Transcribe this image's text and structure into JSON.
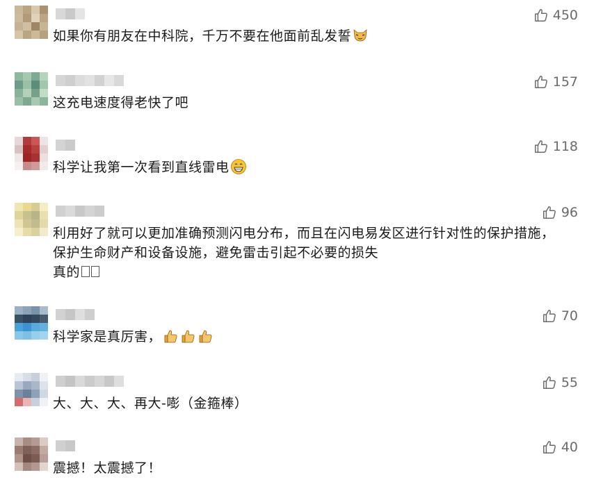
{
  "comments": [
    {
      "likes": "450",
      "text": "如果你有朋友在中科院，千万不要在他面前乱发誓",
      "emoji": "cat-face-icon",
      "avatar_colors": [
        "#c9b89c",
        "#b9a583",
        "#d8c8ae",
        "#a99272",
        "#cdbb9e",
        "#b29a78",
        "#e0d2bb",
        "#bda684",
        "#c5b294",
        "#d0bfa2",
        "#9f8766",
        "#c8b596",
        "#d6c5a7",
        "#bba483",
        "#ccb99a",
        "#b7a07e"
      ],
      "nick_colors": [
        "#d8d8d8",
        "#c9c9c9",
        "#e4e4e4"
      ]
    },
    {
      "likes": "157",
      "text": "这充电速度得老快了吧",
      "avatar_colors": [
        "#8fb89e",
        "#a6c9ad",
        "#7ea995",
        "#b7d3bd",
        "#6f9c8a",
        "#9ac0a5",
        "#5e8c7a",
        "#a3c6ae",
        "#88b39a",
        "#b4d0ba",
        "#789f8c",
        "#c3dcc6",
        "#9bbfa6",
        "#7ea893",
        "#a8c9b0",
        "#8bb59c"
      ],
      "nick_colors": [
        "#d6d6d6",
        "#cfcfcf",
        "#dcdcdc",
        "#e2e2e2",
        "#d2d2d2",
        "#e6e6e6",
        "#d9d9d9"
      ]
    },
    {
      "likes": "118",
      "text": "科学让我第一次看到直线雷电",
      "emoji": "grin-face-icon",
      "avatar_colors": [
        "#e6d8d8",
        "#b33a3a",
        "#c85858",
        "#efe4e4",
        "#d8c2c2",
        "#a52a2a",
        "#b84040",
        "#e2cfcf",
        "#f0e8e8",
        "#9c2424",
        "#a83232",
        "#ece0e0",
        "#f6f0f0",
        "#c88a8a",
        "#d09a9a",
        "#f2eaea"
      ],
      "nick_colors": [
        "#d4d4d4",
        "#cacaca"
      ]
    },
    {
      "likes": "96",
      "text": "利用好了就可以更加准确预测闪电分布，而且在闪电易发区进行针对性的保护措施，保护生命财产和设备设施，避免雷击引起不必要的损失\n真的",
      "avatar_colors": [
        "#f0e6b0",
        "#e8d98e",
        "#d8cc92",
        "#f4ecc2",
        "#e0d49a",
        "#c8c08e",
        "#b8b48a",
        "#e9dfb0",
        "#ede3b6",
        "#d1c691",
        "#c2bb8d",
        "#e4daa9",
        "#f5efcd",
        "#e7dca7",
        "#dcd19d",
        "#f2eaca"
      ],
      "nick_colors": [
        "#d0d0d0",
        "#dadada",
        "#c8c8c8",
        "#d4d4d4",
        "#cccccc"
      ]
    },
    {
      "likes": "70",
      "text": "科学家是真厉害，",
      "emoji": "thumbs-up-emoji-icon",
      "emoji_count": 3,
      "avatar_colors": [
        "#9bb0c4",
        "#8aa2b8",
        "#7892aa",
        "#a9bccd",
        "#3d4f63",
        "#2f4257",
        "#34485e",
        "#485a6d",
        "#4aa0d8",
        "#3b94d0",
        "#56aadd",
        "#62b2e0",
        "#8cc6ea",
        "#7fbfe6",
        "#98cdec",
        "#a5d3ee"
      ],
      "nick_colors": [
        "#d2d2d2",
        "#c6c6c6",
        "#dedede",
        "#cecece"
      ]
    },
    {
      "likes": "55",
      "text": "大、大、大、再大-嘭（金箍棒）",
      "avatar_colors": [
        "#e8ecf2",
        "#d8dee8",
        "#c6cfdb",
        "#eef1f5",
        "#b9c4d4",
        "#98a8be",
        "#a9b7ca",
        "#dde3eb",
        "#7f92ab",
        "#6c8099",
        "#8fa1b6",
        "#cfd7e2",
        "#d46c6c",
        "#e8b4b4",
        "#c8d0dc",
        "#eef1f5"
      ],
      "nick_colors": [
        "#cfcfcf",
        "#c4c4c4",
        "#d9d9d9",
        "#cbcbcb",
        "#d6d6d6",
        "#c8c8c8",
        "#dedede"
      ]
    },
    {
      "likes": "40",
      "text": "震撼！太震撼了！",
      "avatar_colors": [
        "#c8b4ae",
        "#a88c84",
        "#b49a92",
        "#dccbc5",
        "#9a7c72",
        "#7e6058",
        "#8c6c64",
        "#c2aaa2",
        "#b0948a",
        "#6e5048",
        "#7a5c54",
        "#b89e96",
        "#d4c0ba",
        "#a48880",
        "#b29890",
        "#e2d4cf"
      ],
      "nick_colors": [
        "#d0d0d0",
        "#c8c8c8"
      ]
    }
  ]
}
